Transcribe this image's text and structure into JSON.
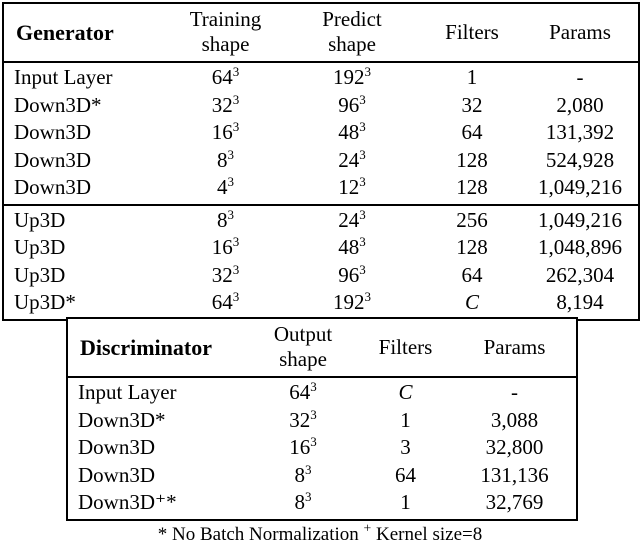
{
  "generator": {
    "header": {
      "name": "Generator",
      "col1_line1": "Training",
      "col1_line2": "shape",
      "col2_line1": "Predict",
      "col2_line2": "shape",
      "col3": "Filters",
      "col4": "Params"
    },
    "rows": [
      {
        "name": "Input Layer",
        "training_shape_base": "64",
        "training_shape_exp": "3",
        "predict_shape_base": "192",
        "predict_shape_exp": "3",
        "filters": "1",
        "params": "-"
      },
      {
        "name": "Down3D*",
        "training_shape_base": "32",
        "training_shape_exp": "3",
        "predict_shape_base": "96",
        "predict_shape_exp": "3",
        "filters": "32",
        "params": "2,080"
      },
      {
        "name": "Down3D",
        "training_shape_base": "16",
        "training_shape_exp": "3",
        "predict_shape_base": "48",
        "predict_shape_exp": "3",
        "filters": "64",
        "params": "131,392"
      },
      {
        "name": "Down3D",
        "training_shape_base": "8",
        "training_shape_exp": "3",
        "predict_shape_base": "24",
        "predict_shape_exp": "3",
        "filters": "128",
        "params": "524,928"
      },
      {
        "name": "Down3D",
        "training_shape_base": "4",
        "training_shape_exp": "3",
        "predict_shape_base": "12",
        "predict_shape_exp": "3",
        "filters": "128",
        "params": "1,049,216"
      },
      {
        "name": "Up3D",
        "training_shape_base": "8",
        "training_shape_exp": "3",
        "predict_shape_base": "24",
        "predict_shape_exp": "3",
        "filters": "256",
        "params": "1,049,216"
      },
      {
        "name": "Up3D",
        "training_shape_base": "16",
        "training_shape_exp": "3",
        "predict_shape_base": "48",
        "predict_shape_exp": "3",
        "filters": "128",
        "params": "1,048,896"
      },
      {
        "name": "Up3D",
        "training_shape_base": "32",
        "training_shape_exp": "3",
        "predict_shape_base": "96",
        "predict_shape_exp": "3",
        "filters": "64",
        "params": "262,304"
      },
      {
        "name": "Up3D*",
        "training_shape_base": "64",
        "training_shape_exp": "3",
        "predict_shape_base": "192",
        "predict_shape_exp": "3",
        "filters": "C",
        "params": "8,194"
      }
    ]
  },
  "discriminator": {
    "header": {
      "name": "Discriminator",
      "col1_line1": "Output",
      "col1_line2": "shape",
      "col2": "Filters",
      "col3": "Params"
    },
    "rows": [
      {
        "name": "Input Layer",
        "output_shape_base": "64",
        "output_shape_exp": "3",
        "filters": "C",
        "params": "-"
      },
      {
        "name": "Down3D*",
        "output_shape_base": "32",
        "output_shape_exp": "3",
        "filters": "1",
        "params": "3,088"
      },
      {
        "name": "Down3D",
        "output_shape_base": "16",
        "output_shape_exp": "3",
        "filters": "3",
        "params": "32,800"
      },
      {
        "name": "Down3D",
        "output_shape_base": "8",
        "output_shape_exp": "3",
        "filters": "64",
        "params": "131,136"
      },
      {
        "name": "Down3D⁺*",
        "output_shape_base": "8",
        "output_shape_exp": "3",
        "filters": "1",
        "params": "32,769"
      }
    ]
  },
  "footnote": {
    "star_symbol": "*",
    "star_text": "No Batch Normalization",
    "plus_symbol": "+",
    "plus_text": "Kernel size=8"
  }
}
